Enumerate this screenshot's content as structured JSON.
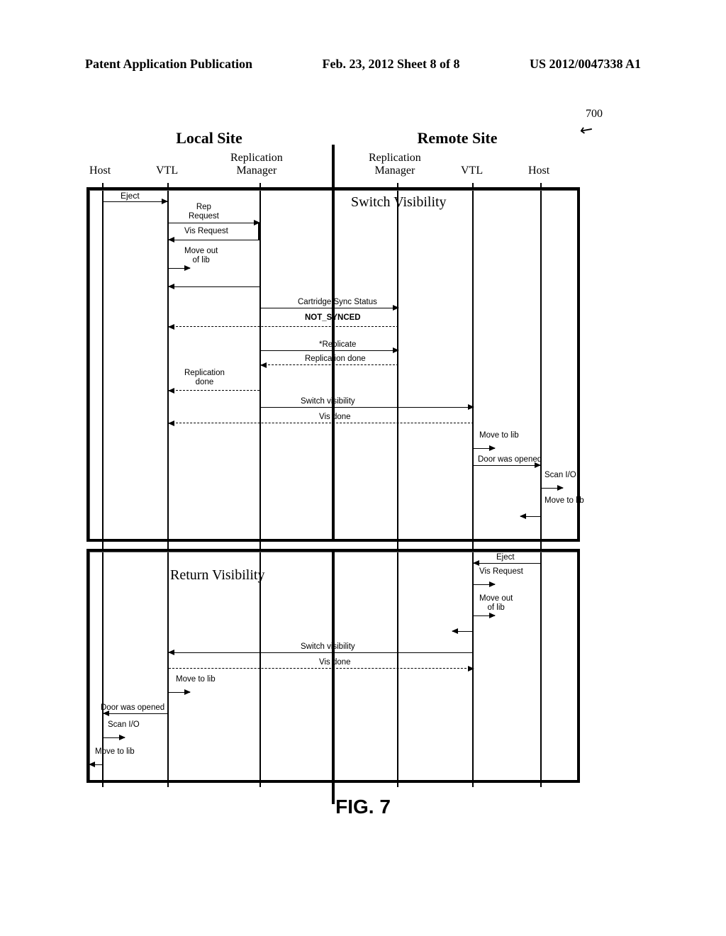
{
  "header": {
    "left": "Patent Application Publication",
    "center": "Feb. 23, 2012  Sheet 8 of 8",
    "right": "US 2012/0047338 A1"
  },
  "diagram": {
    "ref_num": "700",
    "sites": {
      "local": "Local Site",
      "remote": "Remote Site"
    },
    "lanes": {
      "local_host": "Host",
      "local_vtl": "VTL",
      "local_repmgr_l1": "Replication",
      "local_repmgr_l2": "Manager",
      "remote_repmgr_l1": "Replication",
      "remote_repmgr_l2": "Manager",
      "remote_vtl": "VTL",
      "remote_host": "Host"
    },
    "caption": "FIG. 7",
    "panel1": {
      "switch_vis_title": "Switch Visibility",
      "eject": "Eject",
      "rep_request": "Rep\nRequest",
      "vis_request": "Vis Request",
      "move_out": "Move out\nof lib",
      "cart_sync_status": "Cartridge Sync Status",
      "not_synced": "NOT_SYNCED",
      "replicate": "*Replicate",
      "replication_done_mid": "Replication done",
      "replication_done_left": "Replication\ndone",
      "switch_visibility": "Switch visibility",
      "vis_done": "Vis done",
      "move_to_lib_r": "Move to lib",
      "door_opened_r": "Door was opened",
      "scan_io_r": "Scan I/O",
      "move_to_lib_r2": "Move to lib"
    },
    "panel2": {
      "return_vis_title": "Return Visibility",
      "eject": "Eject",
      "vis_request": "Vis Request",
      "move_out": "Move out\nof lib",
      "switch_visibility": "Switch visibility",
      "vis_done": "Vis done",
      "move_to_lib_l": "Move to lib",
      "door_opened_l": "Door was opened",
      "scan_io_l": "Scan I/O",
      "move_to_lib_l2": "Move to lib"
    }
  }
}
